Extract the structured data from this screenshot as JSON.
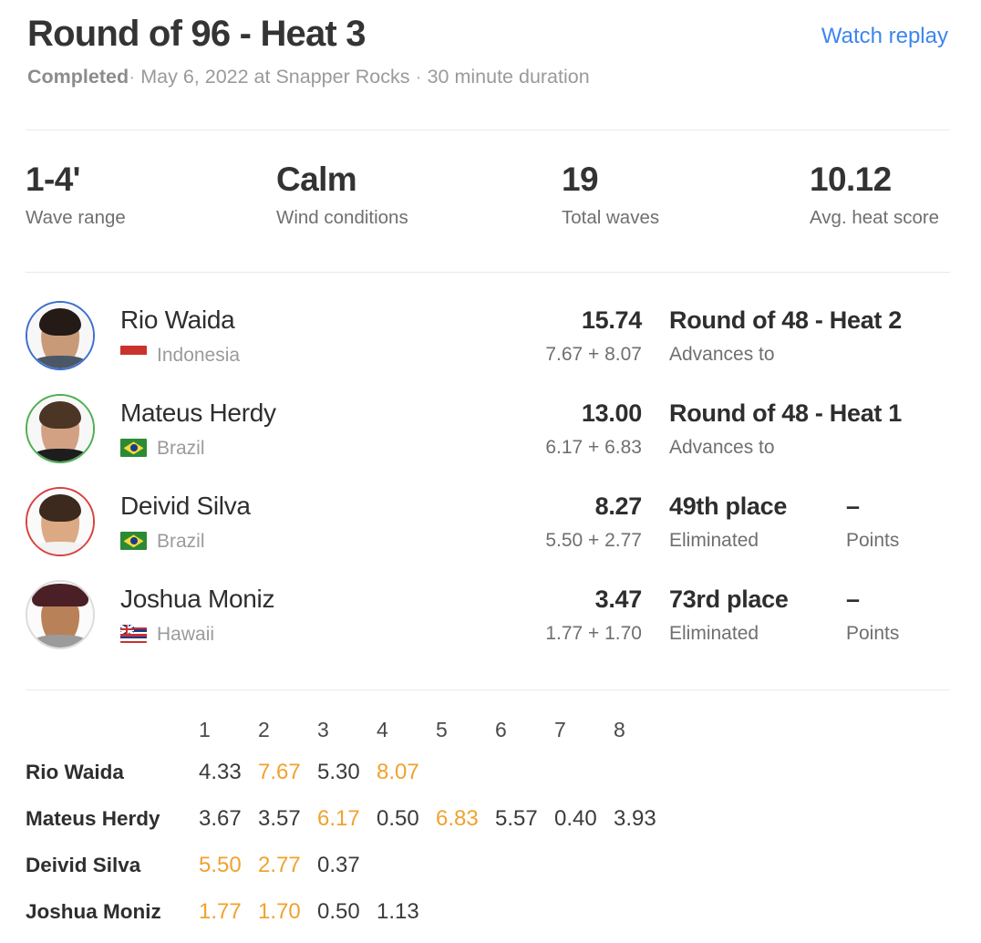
{
  "header": {
    "title": "Round of 96 - Heat 3",
    "watch_replay_label": "Watch replay",
    "status": "Completed",
    "sep1": "·",
    "date_venue": "May 6, 2022 at Snapper Rocks",
    "sep2": "·",
    "duration": "30 minute duration"
  },
  "stats": [
    {
      "value": "1-4'",
      "label": "Wave range"
    },
    {
      "value": "Calm",
      "label": "Wind conditions"
    },
    {
      "value": "19",
      "label": "Total waves"
    },
    {
      "value": "10.12",
      "label": "Avg. heat score"
    }
  ],
  "athletes": [
    {
      "name": "Rio Waida",
      "country": "Indonesia",
      "flag": "indonesia-flag",
      "ring_color": "#3d6fd0",
      "total": "15.74",
      "breakdown": "7.67 + 8.07",
      "result_title": "Round of 48 - Heat 2",
      "result_sub": "Advances to",
      "points_value": "",
      "points_label": "",
      "has_points": false
    },
    {
      "name": "Mateus Herdy",
      "country": "Brazil",
      "flag": "brazil-flag",
      "ring_color": "#4caf50",
      "total": "13.00",
      "breakdown": "6.17 + 6.83",
      "result_title": "Round of 48 - Heat 1",
      "result_sub": "Advances to",
      "points_value": "",
      "points_label": "",
      "has_points": false
    },
    {
      "name": "Deivid Silva",
      "country": "Brazil",
      "flag": "brazil-flag",
      "ring_color": "#d9413f",
      "total": "8.27",
      "breakdown": "5.50 + 2.77",
      "result_title": "49th place",
      "result_sub": "Eliminated",
      "points_value": "–",
      "points_label": "Points",
      "has_points": true
    },
    {
      "name": "Joshua Moniz",
      "country": "Hawaii",
      "flag": "hawaii-flag",
      "ring_color": "#dcdcdc",
      "total": "3.47",
      "breakdown": "1.77 + 1.70",
      "result_title": "73rd place",
      "result_sub": "Eliminated",
      "points_value": "–",
      "points_label": "Points",
      "has_points": true
    }
  ],
  "wave_table": {
    "columns": [
      "1",
      "2",
      "3",
      "4",
      "5",
      "6",
      "7",
      "8"
    ],
    "rows": [
      {
        "athlete": "Rio Waida",
        "scores": [
          "4.33",
          "7.67",
          "5.30",
          "8.07",
          "",
          "",
          "",
          ""
        ],
        "counted": [
          false,
          true,
          false,
          true,
          false,
          false,
          false,
          false
        ]
      },
      {
        "athlete": "Mateus Herdy",
        "scores": [
          "3.67",
          "3.57",
          "6.17",
          "0.50",
          "6.83",
          "5.57",
          "0.40",
          "3.93"
        ],
        "counted": [
          false,
          false,
          true,
          false,
          true,
          false,
          false,
          false
        ]
      },
      {
        "athlete": "Deivid Silva",
        "scores": [
          "5.50",
          "2.77",
          "0.37",
          "",
          "",
          "",
          "",
          ""
        ],
        "counted": [
          true,
          true,
          false,
          false,
          false,
          false,
          false,
          false
        ]
      },
      {
        "athlete": "Joshua Moniz",
        "scores": [
          "1.77",
          "1.70",
          "0.50",
          "1.13",
          "",
          "",
          "",
          ""
        ],
        "counted": [
          true,
          true,
          false,
          false,
          false,
          false,
          false,
          false
        ]
      }
    ]
  },
  "colors": {
    "accent_orange": "#f0a22e",
    "link_blue": "#3d85f0",
    "text_dark": "#2e2e2e",
    "text_muted": "#6f6f6f"
  }
}
